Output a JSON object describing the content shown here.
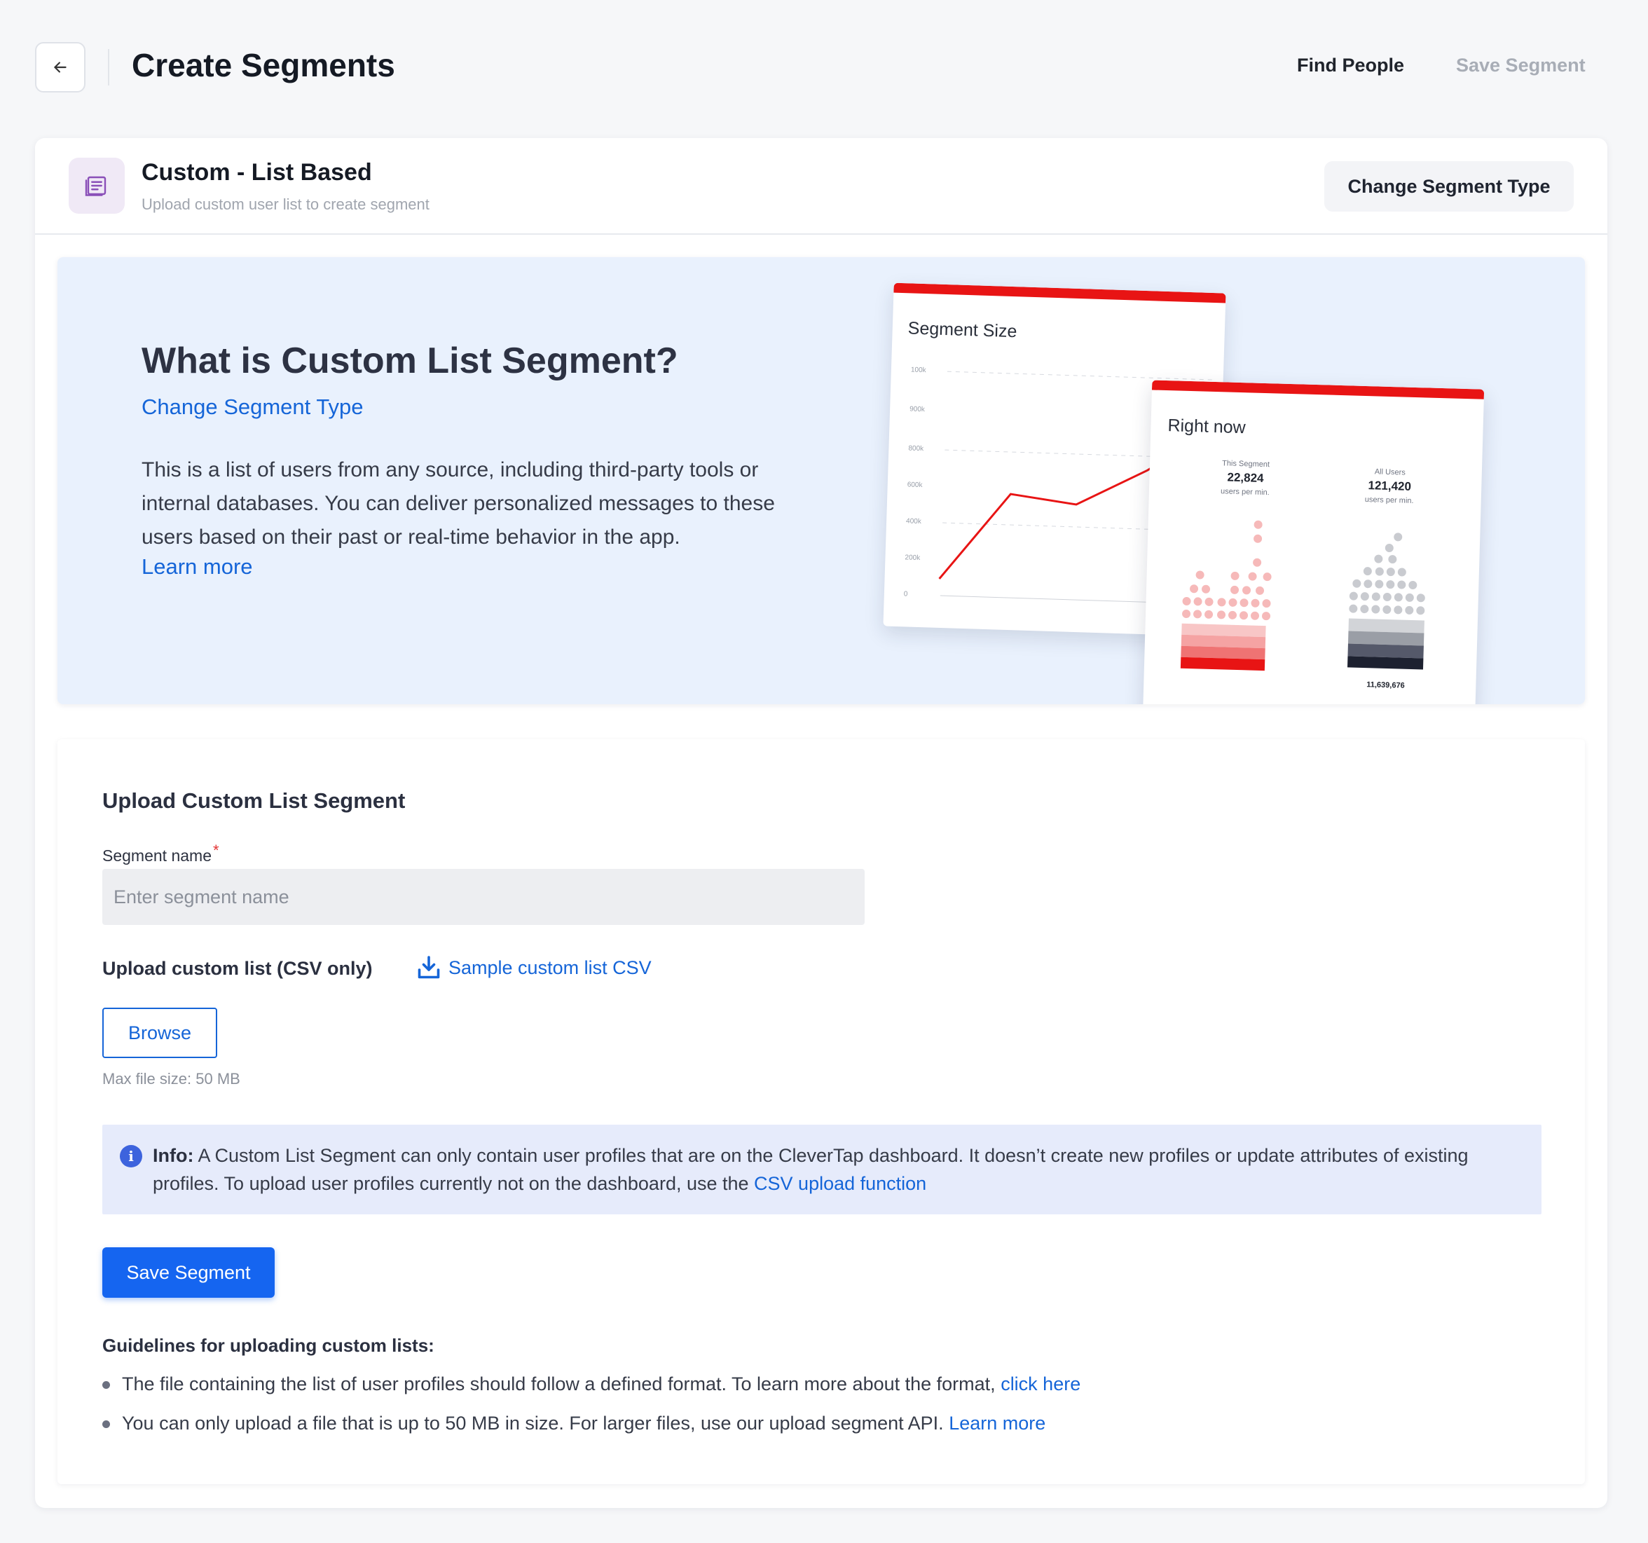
{
  "header": {
    "title": "Create Segments",
    "find_people": "Find People",
    "save_segment": "Save Segment"
  },
  "segment_type": {
    "title": "Custom - List Based",
    "subtitle": "Upload custom user list to create segment",
    "change_button": "Change Segment Type"
  },
  "hero": {
    "title": "What is Custom List Segment?",
    "change_link": "Change Segment Type",
    "description": "This is a list of users from any source, including third-party tools or internal databases. You can deliver personalized messages to these users based on their past or real-time behavior in the app.",
    "learn_more": "Learn more",
    "illustration": {
      "size_card_title": "Segment Size",
      "size_ticks": [
        "100k",
        "900k",
        "800k",
        "600k",
        "400k",
        "200k",
        "0"
      ],
      "now_card_title": "Right now",
      "this_segment": {
        "caption": "This Segment",
        "value": "22,824",
        "unit": "users per min."
      },
      "all_users": {
        "caption": "All Users",
        "value": "121,420",
        "unit": "users per min."
      },
      "all_users_total": "11,639,676"
    }
  },
  "upload": {
    "title": "Upload Custom List Segment",
    "name_label": "Segment name",
    "required_mark": "*",
    "name_placeholder": "Enter segment name",
    "list_label": "Upload custom list (CSV only)",
    "sample_link": "Sample custom list CSV",
    "browse": "Browse",
    "max_size": "Max file size: 50 MB",
    "info_label": "Info:",
    "info_text": " A Custom List Segment can only contain user profiles that are on the CleverTap dashboard. It doesn’t create new profiles or update attributes of existing profiles. To upload user profiles currently not on the dashboard, use the ",
    "info_link": "CSV upload function",
    "save_button": "Save Segment",
    "guidelines_title": "Guidelines for uploading custom lists:",
    "guidelines": [
      {
        "text": "The file containing the list of user profiles should follow a defined format. To learn more about the format, ",
        "link": "click here"
      },
      {
        "text": "You can only upload a file that is up to 50 MB in size. For larger files, use our upload segment API. ",
        "link": "Learn more"
      }
    ]
  },
  "colors": {
    "primary": "#1565f0",
    "link": "#1565d8",
    "hero_bg": "#e9f1fd",
    "info_bg": "#e6ebfb",
    "accent_red": "#e81414"
  }
}
